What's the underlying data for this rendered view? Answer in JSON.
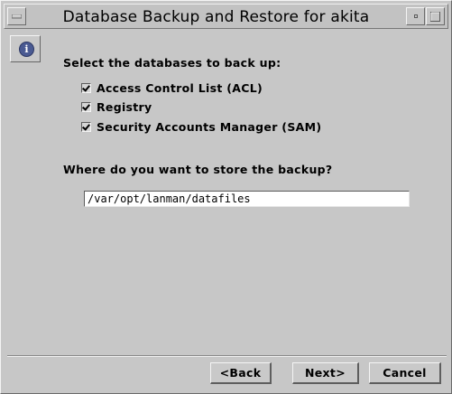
{
  "window": {
    "title": "Database Backup and Restore for akita"
  },
  "prompts": {
    "select_databases": "Select the databases to back up:",
    "store_location": "Where do you want to store the backup?"
  },
  "databases": [
    {
      "label": "Access Control List (ACL)",
      "checked": true
    },
    {
      "label": "Registry",
      "checked": true
    },
    {
      "label": "Security Accounts Manager (SAM)",
      "checked": true
    }
  ],
  "backup_path": {
    "value": "/var/opt/lanman/datafiles"
  },
  "buttons": {
    "back": "<Back",
    "next": "Next>",
    "cancel": "Cancel"
  },
  "icons": {
    "info": "info-icon",
    "window_menu": "window-menu-icon",
    "minimize": "minimize-icon",
    "maximize": "maximize-icon"
  }
}
